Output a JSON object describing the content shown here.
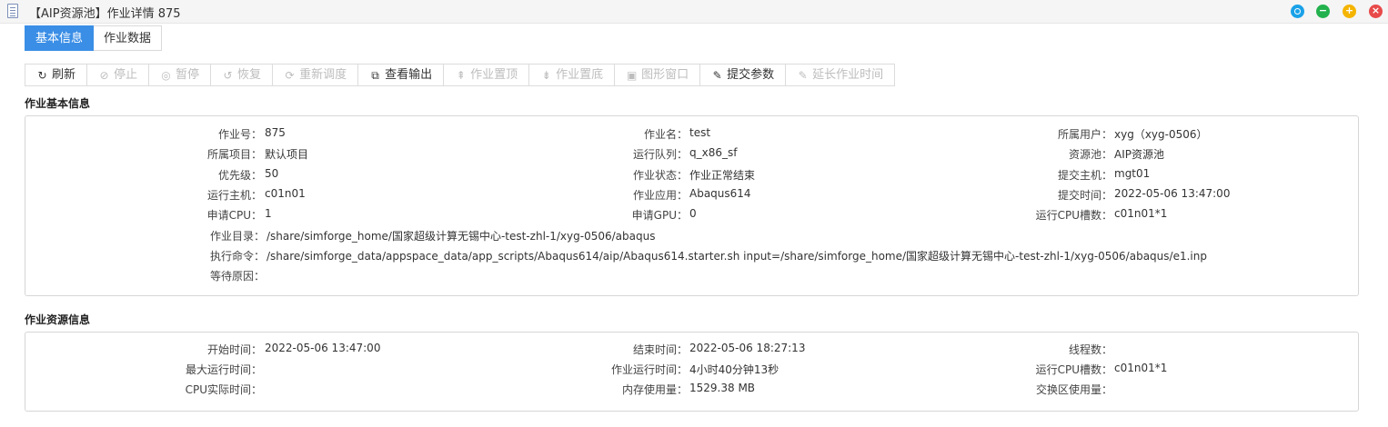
{
  "window": {
    "title": "【AIP资源池】作业详情 875",
    "controls": {
      "restore": "restore-icon",
      "minimize": "−",
      "maximize": "+",
      "close": "×"
    }
  },
  "tabs": [
    {
      "label": "基本信息",
      "active": true
    },
    {
      "label": "作业数据",
      "active": false
    }
  ],
  "toolbar": [
    {
      "label": "刷新",
      "icon": "↻",
      "enabled": true
    },
    {
      "label": "停止",
      "icon": "⊘",
      "enabled": false
    },
    {
      "label": "暂停",
      "icon": "◎",
      "enabled": false
    },
    {
      "label": "恢复",
      "icon": "↺",
      "enabled": false
    },
    {
      "label": "重新调度",
      "icon": "⟳",
      "enabled": false
    },
    {
      "label": "查看输出",
      "icon": "⧉",
      "enabled": true
    },
    {
      "label": "作业置顶",
      "icon": "⇞",
      "enabled": false
    },
    {
      "label": "作业置底",
      "icon": "⇟",
      "enabled": false
    },
    {
      "label": "图形窗口",
      "icon": "▣",
      "enabled": false
    },
    {
      "label": "提交参数",
      "icon": "✎",
      "enabled": true
    },
    {
      "label": "延长作业时间",
      "icon": "✎",
      "enabled": false
    }
  ],
  "basic_info": {
    "title": "作业基本信息",
    "col1": [
      {
        "label": "作业号：",
        "value": "875"
      },
      {
        "label": "所属项目：",
        "value": "默认项目"
      },
      {
        "label": "优先级：",
        "value": "50"
      },
      {
        "label": "运行主机：",
        "value": "c01n01"
      },
      {
        "label": "申请CPU：",
        "value": "1"
      }
    ],
    "col2": [
      {
        "label": "作业名：",
        "value": "test"
      },
      {
        "label": "运行队列：",
        "value": "q_x86_sf"
      },
      {
        "label": "作业状态：",
        "value": "作业正常结束"
      },
      {
        "label": "作业应用：",
        "value": "Abaqus614"
      },
      {
        "label": "申请GPU：",
        "value": "0"
      }
    ],
    "col3": [
      {
        "label": "所属用户：",
        "value": "xyg（xyg-0506）"
      },
      {
        "label": "资源池：",
        "value": "AIP资源池"
      },
      {
        "label": "提交主机：",
        "value": "mgt01"
      },
      {
        "label": "提交时间：",
        "value": "2022-05-06 13:47:00"
      },
      {
        "label": "运行CPU槽数：",
        "value": "c01n01*1"
      }
    ],
    "wide": [
      {
        "label": "作业目录：",
        "value": "/share/simforge_home/国家超级计算无锡中心-test-zhl-1/xyg-0506/abaqus"
      },
      {
        "label": "执行命令：",
        "value": "/share/simforge_data/appspace_data/app_scripts/Abaqus614/aip/Abaqus614.starter.sh input=/share/simforge_home/国家超级计算无锡中心-test-zhl-1/xyg-0506/abaqus/e1.inp"
      },
      {
        "label": "等待原因：",
        "value": ""
      }
    ]
  },
  "resource_info": {
    "title": "作业资源信息",
    "col1": [
      {
        "label": "开始时间：",
        "value": "2022-05-06 13:47:00"
      },
      {
        "label": "最大运行时间：",
        "value": ""
      },
      {
        "label": "CPU实际时间：",
        "value": ""
      }
    ],
    "col2": [
      {
        "label": "结束时间：",
        "value": "2022-05-06 18:27:13"
      },
      {
        "label": "作业运行时间：",
        "value": "4小时40分钟13秒"
      },
      {
        "label": "内存使用量：",
        "value": "1529.38 MB"
      }
    ],
    "col3": [
      {
        "label": "线程数：",
        "value": ""
      },
      {
        "label": "运行CPU槽数：",
        "value": "c01n01*1"
      },
      {
        "label": "交换区使用量：",
        "value": ""
      }
    ]
  }
}
